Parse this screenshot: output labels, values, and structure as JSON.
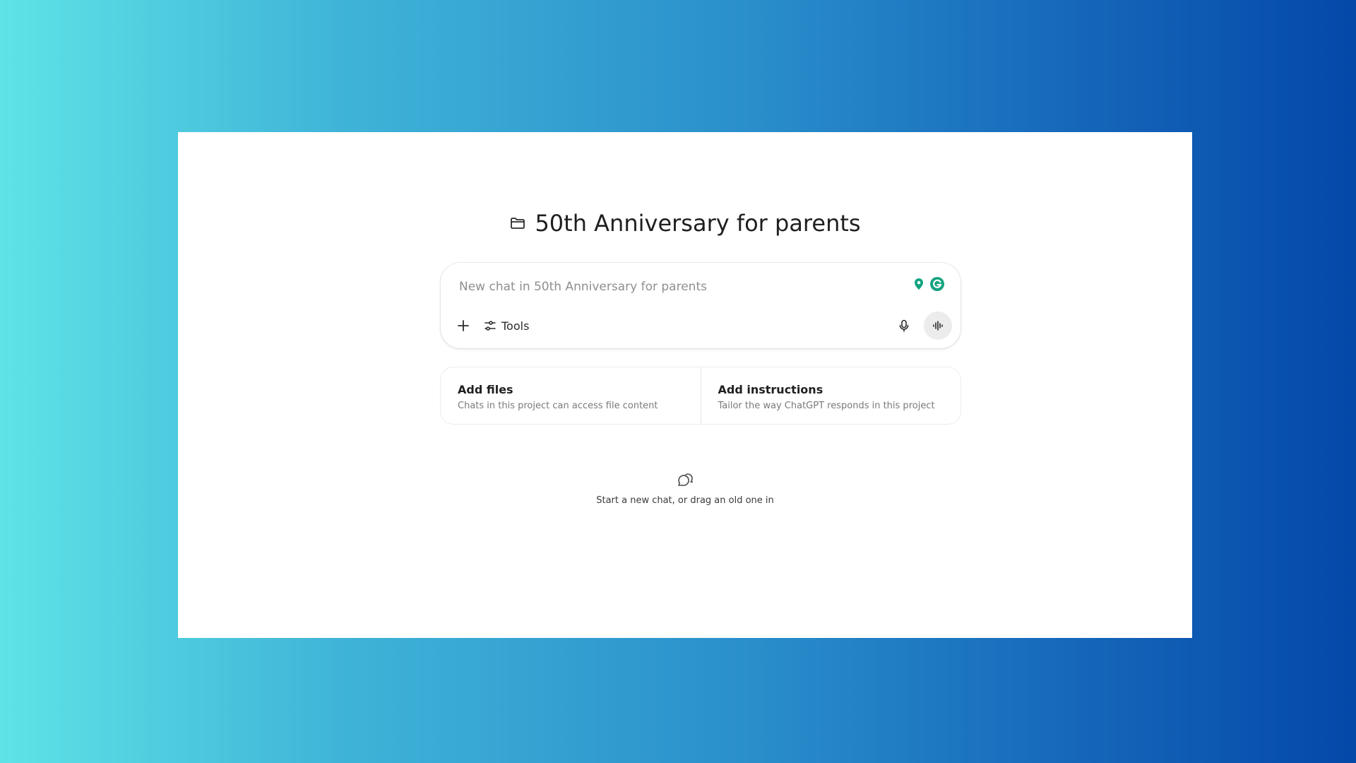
{
  "project": {
    "title": "50th Anniversary for parents",
    "folder_icon": "folder-icon"
  },
  "composer": {
    "placeholder": "New chat in 50th Anniversary for parents",
    "value": "",
    "add_icon": "plus-icon",
    "tools_label": "Tools",
    "tools_icon": "sliders-icon",
    "mic_icon": "microphone-icon",
    "voice_icon": "voice-waveform-icon",
    "extensions": [
      {
        "name": "location-pin-extension-icon",
        "color": "#10a37f"
      },
      {
        "name": "grammarly-extension-icon",
        "color": "#15c39a"
      }
    ]
  },
  "cards": [
    {
      "title": "Add files",
      "subtitle": "Chats in this project can access file content"
    },
    {
      "title": "Add instructions",
      "subtitle": "Tailor the way ChatGPT responds in this project"
    }
  ],
  "empty_state": {
    "icon": "chat-bubbles-icon",
    "text": "Start a new chat, or drag an old one in"
  }
}
